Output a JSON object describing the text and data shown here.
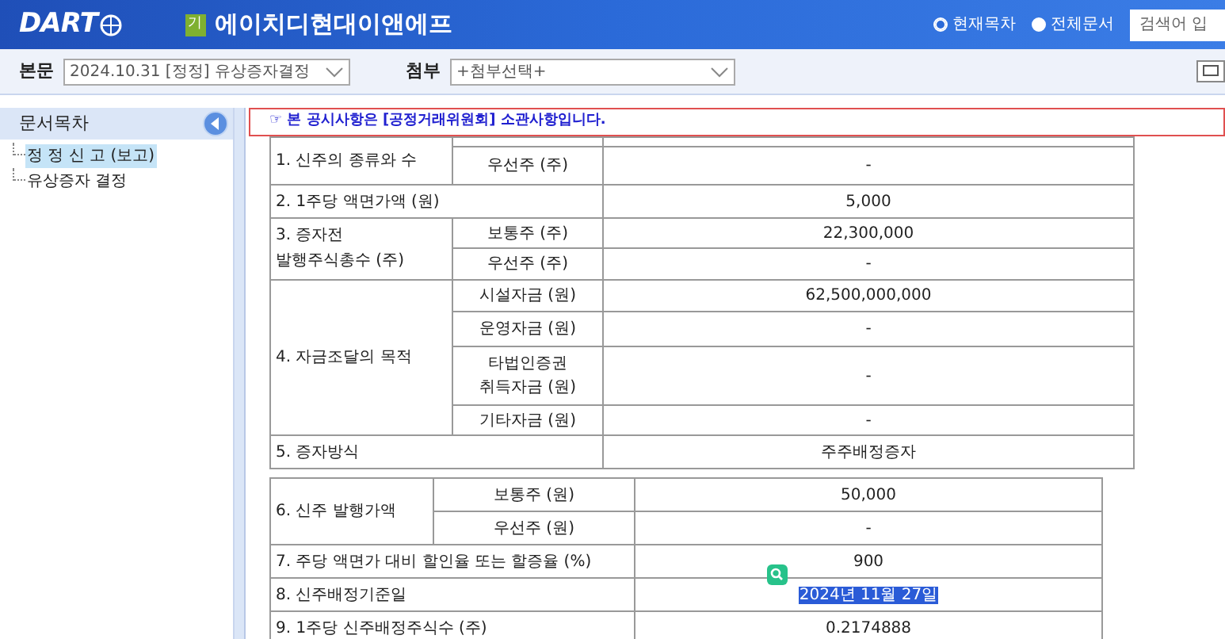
{
  "header": {
    "logo": "DART",
    "badge": "기",
    "company": "에이치디현대이앤에프",
    "scope_options": [
      {
        "label": "현재목차",
        "selected": true
      },
      {
        "label": "전체문서",
        "selected": false
      }
    ],
    "search": {
      "placeholder": "검색어 입"
    }
  },
  "toolbar": {
    "main_label": "본문",
    "main_value": "2024.10.31  [정정] 유상증자결정",
    "attach_label": "첨부",
    "attach_value": "+첨부선택+"
  },
  "sidebar": {
    "title": "문서목차",
    "items": [
      {
        "label": "정 정 신 고 (보고)",
        "selected": true
      },
      {
        "label": "유상증자 결정",
        "selected": false
      }
    ]
  },
  "notice": "☞ 본 공시사항은 [공정거래위원회] 소관사항입니다.",
  "tables": [
    {
      "groups": [
        {
          "label": "1. 신주의 종류와 수",
          "subrows": [
            {
              "label": "",
              "value": ""
            },
            {
              "label": "우선주 (주)",
              "value": "-"
            }
          ]
        },
        {
          "label": "2. 1주당 액면가액 (원)",
          "value": "5,000"
        },
        {
          "label": "3. 증자전\n발행주식총수 (주)",
          "subrows": [
            {
              "label": "보통주 (주)",
              "value": "22,300,000"
            },
            {
              "label": "우선주 (주)",
              "value": "-"
            }
          ]
        },
        {
          "label": "4. 자금조달의 목적",
          "subrows": [
            {
              "label": "시설자금 (원)",
              "value": "62,500,000,000"
            },
            {
              "label": "운영자금 (원)",
              "value": "-"
            },
            {
              "label": "타법인증권\n취득자금 (원)",
              "value": "-"
            },
            {
              "label": "기타자금 (원)",
              "value": "-"
            }
          ]
        },
        {
          "label": "5. 증자방식",
          "value": "주주배정증자"
        }
      ]
    },
    {
      "groups": [
        {
          "label": "6. 신주 발행가액",
          "subrows": [
            {
              "label": "보통주 (원)",
              "value": "50,000"
            },
            {
              "label": "우선주 (원)",
              "value": "-"
            }
          ]
        },
        {
          "label": "7. 주당 액면가 대비 할인율 또는 할증율 (%)",
          "value": "900"
        },
        {
          "label": "8. 신주배정기준일",
          "value": "2024년 11월 27일",
          "selected": true
        },
        {
          "label": "9. 1주당 신주배정주식수 (주)",
          "value": "0.2174888"
        }
      ]
    }
  ]
}
